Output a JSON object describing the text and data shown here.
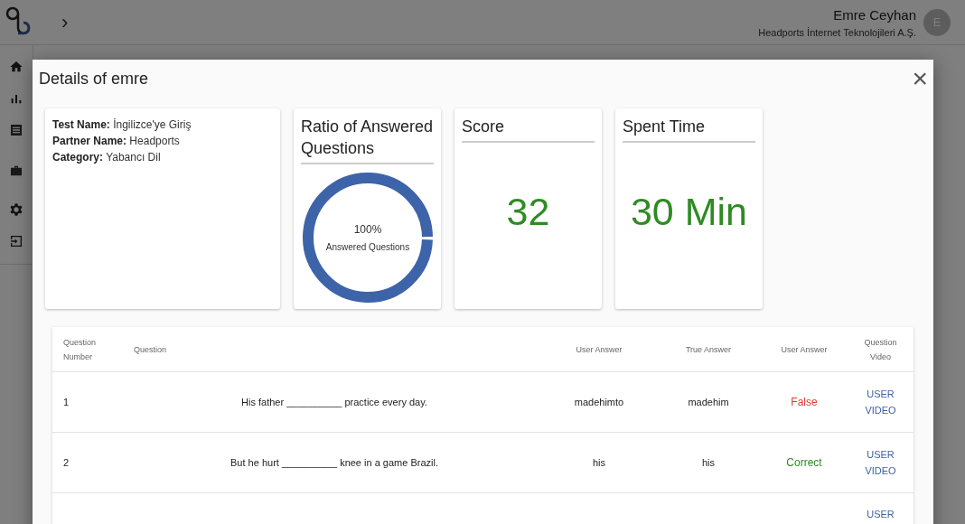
{
  "header": {
    "user_name": "Emre Ceyhan",
    "company": "Headports İnternet Teknolojileri A.Ş.",
    "avatar_initial": "E",
    "expand": "›"
  },
  "dialog": {
    "title": "Details of emre",
    "close": "×",
    "info": [
      {
        "label": "Test Name:",
        "value": "İngilizce'ye Giriş"
      },
      {
        "label": "Partner Name:",
        "value": "Headports"
      },
      {
        "label": "Category:",
        "value": "Yabancı Dil"
      }
    ],
    "ratio": {
      "title": "Ratio of Answered Questions",
      "percent": "100%",
      "caption": "Answered Questions",
      "level": 1
    },
    "score": {
      "title": "Score",
      "value": "32"
    },
    "spent_time": {
      "title": "Spent Time",
      "value": "30 Min"
    },
    "table": {
      "columns": [
        "Question Number",
        "Question",
        "User Answer",
        "True Answer",
        "User Answer",
        "Question Video"
      ],
      "rows": [
        {
          "number": "1",
          "question": "His father __________ practice every day.",
          "user_answer": "madehimto",
          "true_answer": "madehim",
          "result": "False",
          "correct": false,
          "video": "USER VIDEO"
        },
        {
          "number": "2",
          "question": "But he hurt __________ knee in a game Brazil.",
          "user_answer": "his",
          "true_answer": "his",
          "result": "Correct",
          "correct": true,
          "video": "USER VIDEO"
        },
        {
          "video": "USER"
        }
      ]
    }
  }
}
